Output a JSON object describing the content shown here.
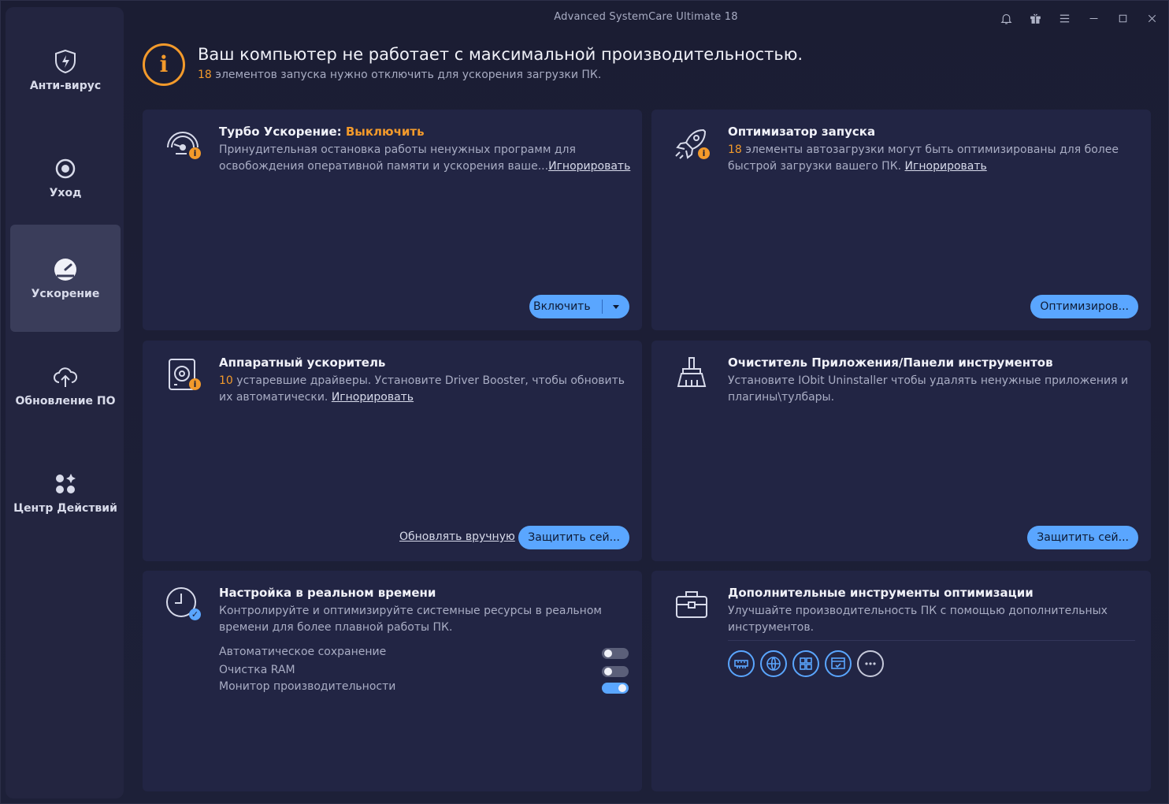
{
  "app": {
    "title": "Advanced SystemCare Ultimate  18"
  },
  "sidebar": {
    "items": [
      {
        "label": "Анти-вирус",
        "icon": "shield-bolt-icon"
      },
      {
        "label": "Уход",
        "icon": "care-cycle-icon"
      },
      {
        "label": "Ускорение",
        "icon": "speedometer-icon",
        "active": true
      },
      {
        "label": "Обновление ПО",
        "icon": "cloud-upload-icon"
      },
      {
        "label": "Центр Действий",
        "icon": "apps-grid-icon"
      }
    ]
  },
  "alert": {
    "title": "Ваш компьютер не работает с максимальной производительностью.",
    "count": "18",
    "subtitle": " элементов запуска нужно отключить для ускорения загрузки ПК."
  },
  "cards": {
    "turbo": {
      "title": "Турбо Ускорение: ",
      "status": "Выключить",
      "desc": "Принудительная остановка работы ненужных программ для освобождения оперативной памяти и ускорения ваше...",
      "ignore": "Игнорировать",
      "button": "Включить"
    },
    "startup": {
      "title": "Оптимизатор запуска",
      "count": "18",
      "desc": " элементы автозагрузки могут быть оптимизированы для более быстрой загрузки вашего ПК. ",
      "ignore": "Игнорировать",
      "button": "Оптимизиров..."
    },
    "hardware": {
      "title": "Аппаратный ускоритель",
      "count": "10",
      "desc": " устаревшие драйверы. Установите Driver Booster, чтобы обновить их автоматически. ",
      "ignore": "Игнорировать",
      "manual": "Обновлять вручную",
      "button": "Защитить сей..."
    },
    "cleaner": {
      "title": "Очиститель Приложения/Панели инструментов",
      "desc": "Установите IObit Uninstaller чтобы удалять ненужные приложения и плагины\\тулбары.",
      "button": "Защитить сей..."
    },
    "realtime": {
      "title": "Настройка в реальном времени",
      "desc": "Контролируйте и оптимизируйте системные ресурсы в реальном времени для более плавной работы ПК.",
      "toggles": [
        {
          "label": "Автоматическое сохранение",
          "on": false
        },
        {
          "label": "Очистка RAM",
          "on": false
        },
        {
          "label": "Монитор производительности",
          "on": true
        }
      ]
    },
    "tools": {
      "title": "Дополнительные инструменты оптимизации",
      "desc": "Улучшайте производительность ПК с помощью дополнительных инструментов.",
      "icons": [
        "ram-icon",
        "internet-booster-icon",
        "apps-icon",
        "window-check-icon",
        "more-icon"
      ]
    }
  },
  "colors": {
    "accent": "#5aa6ff",
    "warning": "#f39a2b",
    "background": "#1b1d33",
    "card": "#222544"
  }
}
